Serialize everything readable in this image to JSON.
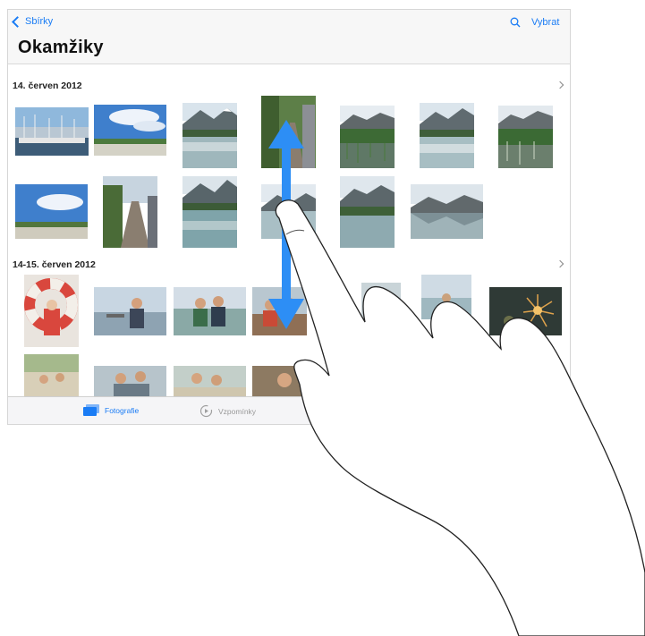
{
  "nav": {
    "back_label": "Sbírky",
    "title": "Okamžiky",
    "select_label": "Vybrat"
  },
  "sections": [
    {
      "date": "14. červen 2012",
      "photo_count": 13
    },
    {
      "date": "14-15. červen 2012",
      "photo_count": 13
    }
  ],
  "tabbar": {
    "tabs": [
      {
        "label": "Fotografie",
        "icon": "photos-icon",
        "selected": true
      },
      {
        "label": "Vzpomínky",
        "icon": "memories-icon",
        "selected": false
      }
    ]
  },
  "gesture": {
    "type": "vertical-swipe",
    "arrow_color": "#2d8ef5"
  },
  "colors": {
    "accent": "#1a7cf5"
  }
}
